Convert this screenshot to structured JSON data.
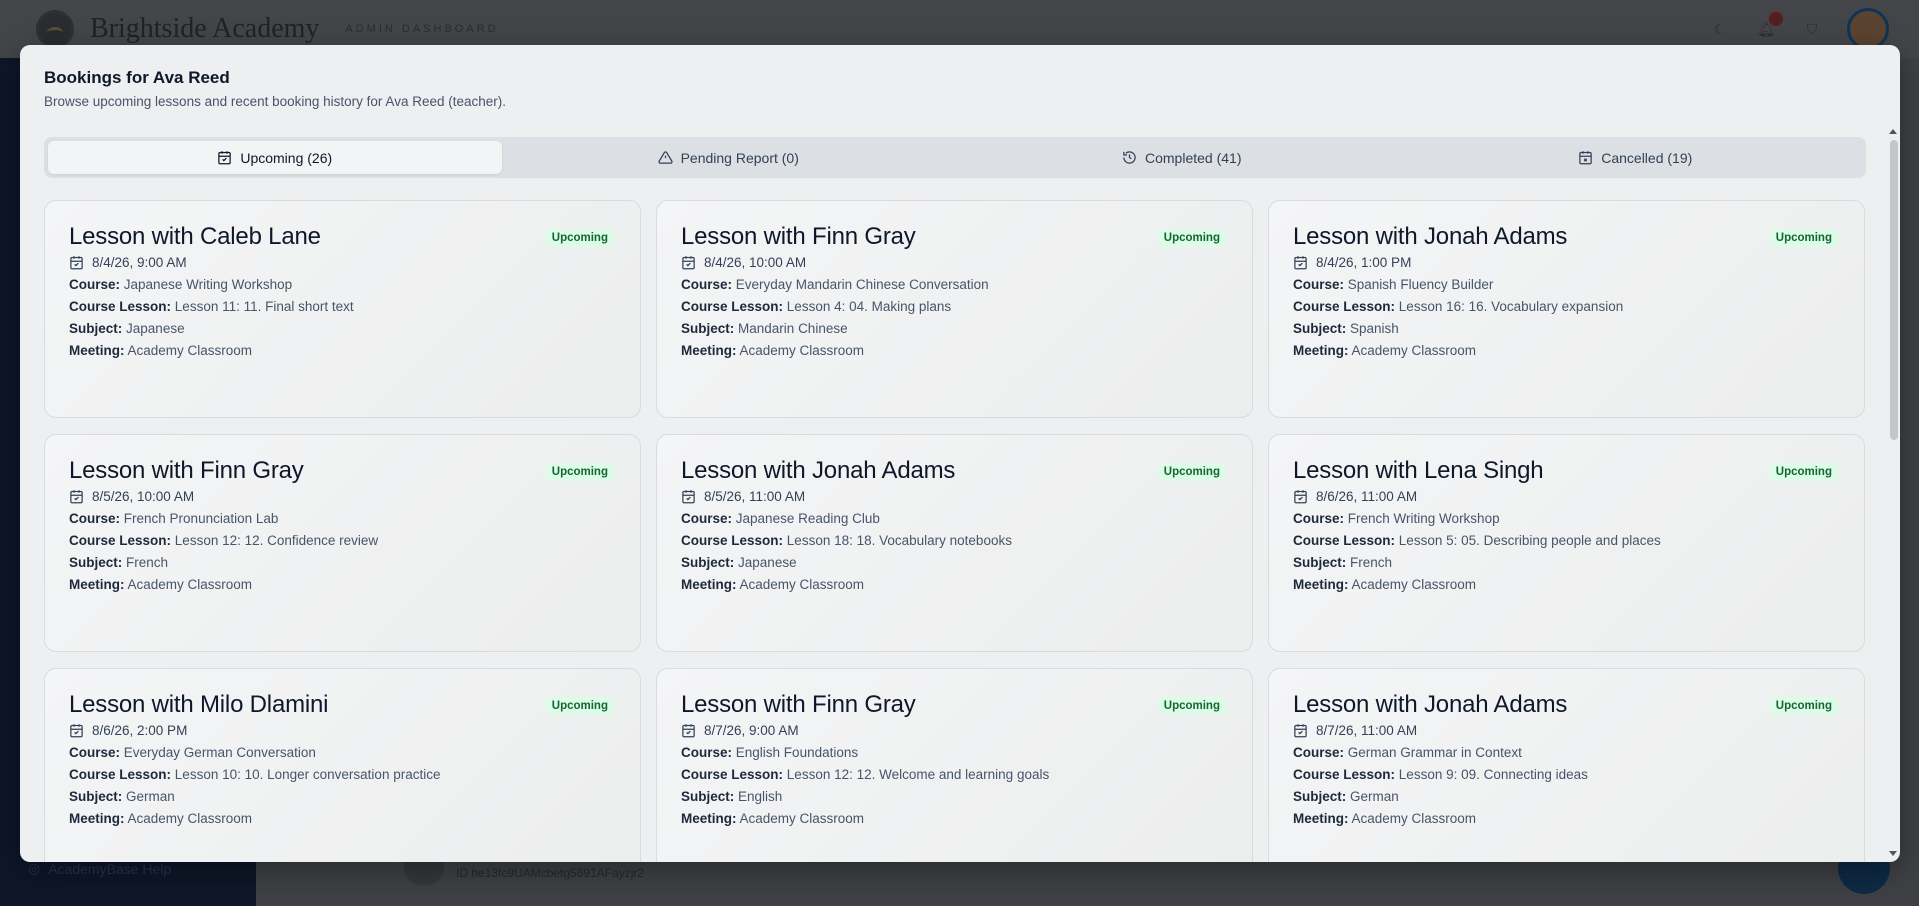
{
  "app": {
    "brand": "Brightside Academy",
    "brand_sub": "ADMIN DASHBOARD",
    "notification_count": "3",
    "help_label": "AcademyBase Help",
    "bg_row_id": "ID he13fc9UAMcbetg5691AFayzjr2"
  },
  "modal": {
    "title": "Bookings for Ava Reed",
    "description": "Browse upcoming lessons and recent booking history for Ava Reed (teacher).",
    "tabs": [
      {
        "label": "Upcoming (26)",
        "icon": "calendar-check-icon",
        "active": true
      },
      {
        "label": "Pending Report (0)",
        "icon": "warning-triangle-icon",
        "active": false
      },
      {
        "label": "Completed (41)",
        "icon": "history-icon",
        "active": false
      },
      {
        "label": "Cancelled (19)",
        "icon": "calendar-x-icon",
        "active": false
      }
    ],
    "labels": {
      "course": "Course:",
      "course_lesson": "Course Lesson:",
      "subject": "Subject:",
      "meeting": "Meeting:"
    },
    "cards": [
      {
        "title": "Lesson with Caleb Lane",
        "status": "Upcoming",
        "date": "8/4/26, 9:00 AM",
        "course": "Japanese Writing Workshop",
        "lesson": "Lesson 11: 11. Final short text",
        "subject": "Japanese",
        "meeting": "Academy Classroom"
      },
      {
        "title": "Lesson with Finn Gray",
        "status": "Upcoming",
        "date": "8/4/26, 10:00 AM",
        "course": "Everyday Mandarin Chinese Conversation",
        "lesson": "Lesson 4: 04. Making plans",
        "subject": "Mandarin Chinese",
        "meeting": "Academy Classroom"
      },
      {
        "title": "Lesson with Jonah Adams",
        "status": "Upcoming",
        "date": "8/4/26, 1:00 PM",
        "course": "Spanish Fluency Builder",
        "lesson": "Lesson 16: 16. Vocabulary expansion",
        "subject": "Spanish",
        "meeting": "Academy Classroom"
      },
      {
        "title": "Lesson with Finn Gray",
        "status": "Upcoming",
        "date": "8/5/26, 10:00 AM",
        "course": "French Pronunciation Lab",
        "lesson": "Lesson 12: 12. Confidence review",
        "subject": "French",
        "meeting": "Academy Classroom"
      },
      {
        "title": "Lesson with Jonah Adams",
        "status": "Upcoming",
        "date": "8/5/26, 11:00 AM",
        "course": "Japanese Reading Club",
        "lesson": "Lesson 18: 18. Vocabulary notebooks",
        "subject": "Japanese",
        "meeting": "Academy Classroom"
      },
      {
        "title": "Lesson with Lena Singh",
        "status": "Upcoming",
        "date": "8/6/26, 11:00 AM",
        "course": "French Writing Workshop",
        "lesson": "Lesson 5: 05. Describing people and places",
        "subject": "French",
        "meeting": "Academy Classroom"
      },
      {
        "title": "Lesson with Milo Dlamini",
        "status": "Upcoming",
        "date": "8/6/26, 2:00 PM",
        "course": "Everyday German Conversation",
        "lesson": "Lesson 10: 10. Longer conversation practice",
        "subject": "German",
        "meeting": "Academy Classroom"
      },
      {
        "title": "Lesson with Finn Gray",
        "status": "Upcoming",
        "date": "8/7/26, 9:00 AM",
        "course": "English Foundations",
        "lesson": "Lesson 12: 12. Welcome and learning goals",
        "subject": "English",
        "meeting": "Academy Classroom"
      },
      {
        "title": "Lesson with Jonah Adams",
        "status": "Upcoming",
        "date": "8/7/26, 11:00 AM",
        "course": "German Grammar in Context",
        "lesson": "Lesson 9: 09. Connecting ideas",
        "subject": "German",
        "meeting": "Academy Classroom"
      }
    ]
  },
  "colors": {
    "badge_bg": "#dcfce7",
    "badge_text": "#166534",
    "sidebar": "#0e1628"
  }
}
